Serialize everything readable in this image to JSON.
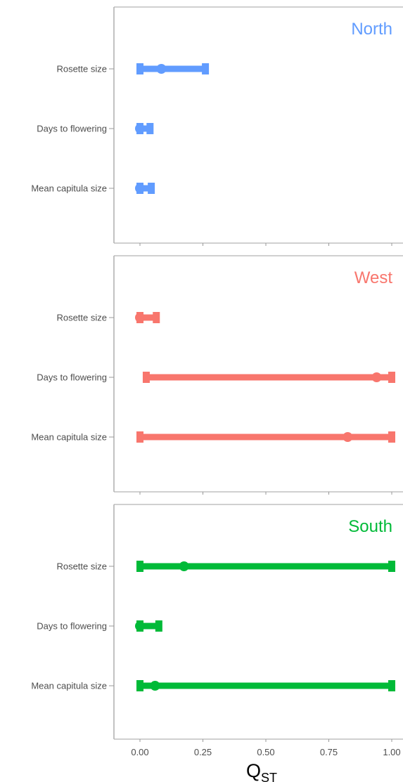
{
  "chart_data": {
    "type": "interval",
    "xlabel_main": "Q",
    "xlabel_sub": "ST",
    "xlim": [
      -0.11,
      1.05
    ],
    "x_ticks": [
      {
        "value": 0.0,
        "label": "0.00"
      },
      {
        "value": 0.25,
        "label": "0.25"
      },
      {
        "value": 0.5,
        "label": "0.50"
      },
      {
        "value": 0.75,
        "label": "0.75"
      },
      {
        "value": 1.0,
        "label": "1.00"
      }
    ],
    "categories": [
      "Rosette size",
      "Days to flowering",
      "Mean capitula size"
    ],
    "panels": [
      {
        "name": "North",
        "color": "#619CFF",
        "rows": [
          {
            "trait": "Rosette size",
            "estimate": 0.085,
            "lower": 0.0,
            "upper": 0.26
          },
          {
            "trait": "Days to flowering",
            "estimate": 0.0,
            "lower": 0.0,
            "upper": 0.04
          },
          {
            "trait": "Mean capitula size",
            "estimate": 0.0,
            "lower": 0.0,
            "upper": 0.045
          }
        ]
      },
      {
        "name": "West",
        "color": "#F8766D",
        "rows": [
          {
            "trait": "Rosette size",
            "estimate": 0.0,
            "lower": 0.0,
            "upper": 0.065
          },
          {
            "trait": "Days to flowering",
            "estimate": 0.94,
            "lower": 0.025,
            "upper": 1.0
          },
          {
            "trait": "Mean capitula size",
            "estimate": 0.825,
            "lower": 0.0,
            "upper": 1.0
          }
        ]
      },
      {
        "name": "South",
        "color": "#00BA38",
        "rows": [
          {
            "trait": "Rosette size",
            "estimate": 0.175,
            "lower": 0.0,
            "upper": 1.0
          },
          {
            "trait": "Days to flowering",
            "estimate": 0.0,
            "lower": 0.0,
            "upper": 0.075
          },
          {
            "trait": "Mean capitula size",
            "estimate": 0.06,
            "lower": 0.0,
            "upper": 1.0
          }
        ]
      }
    ],
    "grid": false,
    "legend": "none"
  }
}
